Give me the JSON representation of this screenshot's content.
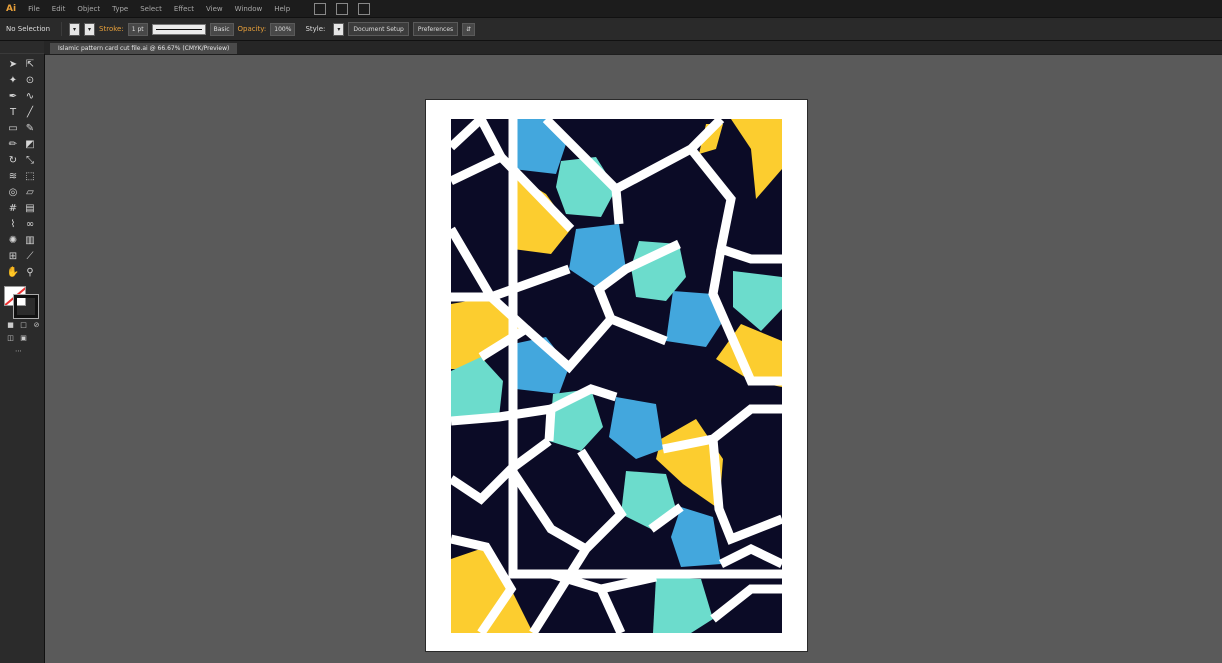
{
  "app": {
    "logo_text": "Ai"
  },
  "menu": {
    "items": [
      "File",
      "Edit",
      "Object",
      "Type",
      "Select",
      "Effect",
      "View",
      "Window",
      "Help"
    ]
  },
  "control_bar": {
    "selection_label": "No Selection",
    "stroke_label": "Stroke:",
    "stroke_weight": "1 pt",
    "stroke_profile": "Basic",
    "opacity_label": "Opacity:",
    "opacity_value": "100%",
    "style_label": "Style:",
    "document_setup_button": "Document Setup",
    "preferences_button": "Preferences"
  },
  "document": {
    "tab_title": "Islamic pattern card cut file.ai @ 66.67% (CMYK/Preview)"
  },
  "colors": {
    "navy": "#0b0b26",
    "yellow": "#fccd2f",
    "teal": "#6cdccc",
    "blue": "#43a7dd",
    "canvas": "#5a5a5a",
    "panel": "#2b2b2b",
    "accent": "#e8a03a"
  },
  "tools": [
    "selection-icon",
    "direct-selection-icon",
    "magic-wand-icon",
    "lasso-icon",
    "pen-icon",
    "curvature-icon",
    "type-icon",
    "line-segment-icon",
    "rectangle-icon",
    "paintbrush-icon",
    "pencil-icon",
    "eraser-icon",
    "rotate-icon",
    "scale-icon",
    "warp-icon",
    "free-transform-icon",
    "shape-builder-icon",
    "perspective-icon",
    "mesh-icon",
    "gradient-icon",
    "eyedropper-icon",
    "blend-icon",
    "symbol-sprayer-icon",
    "column-graph-icon",
    "artboard-icon",
    "slice-icon",
    "hand-icon",
    "zoom-icon"
  ]
}
